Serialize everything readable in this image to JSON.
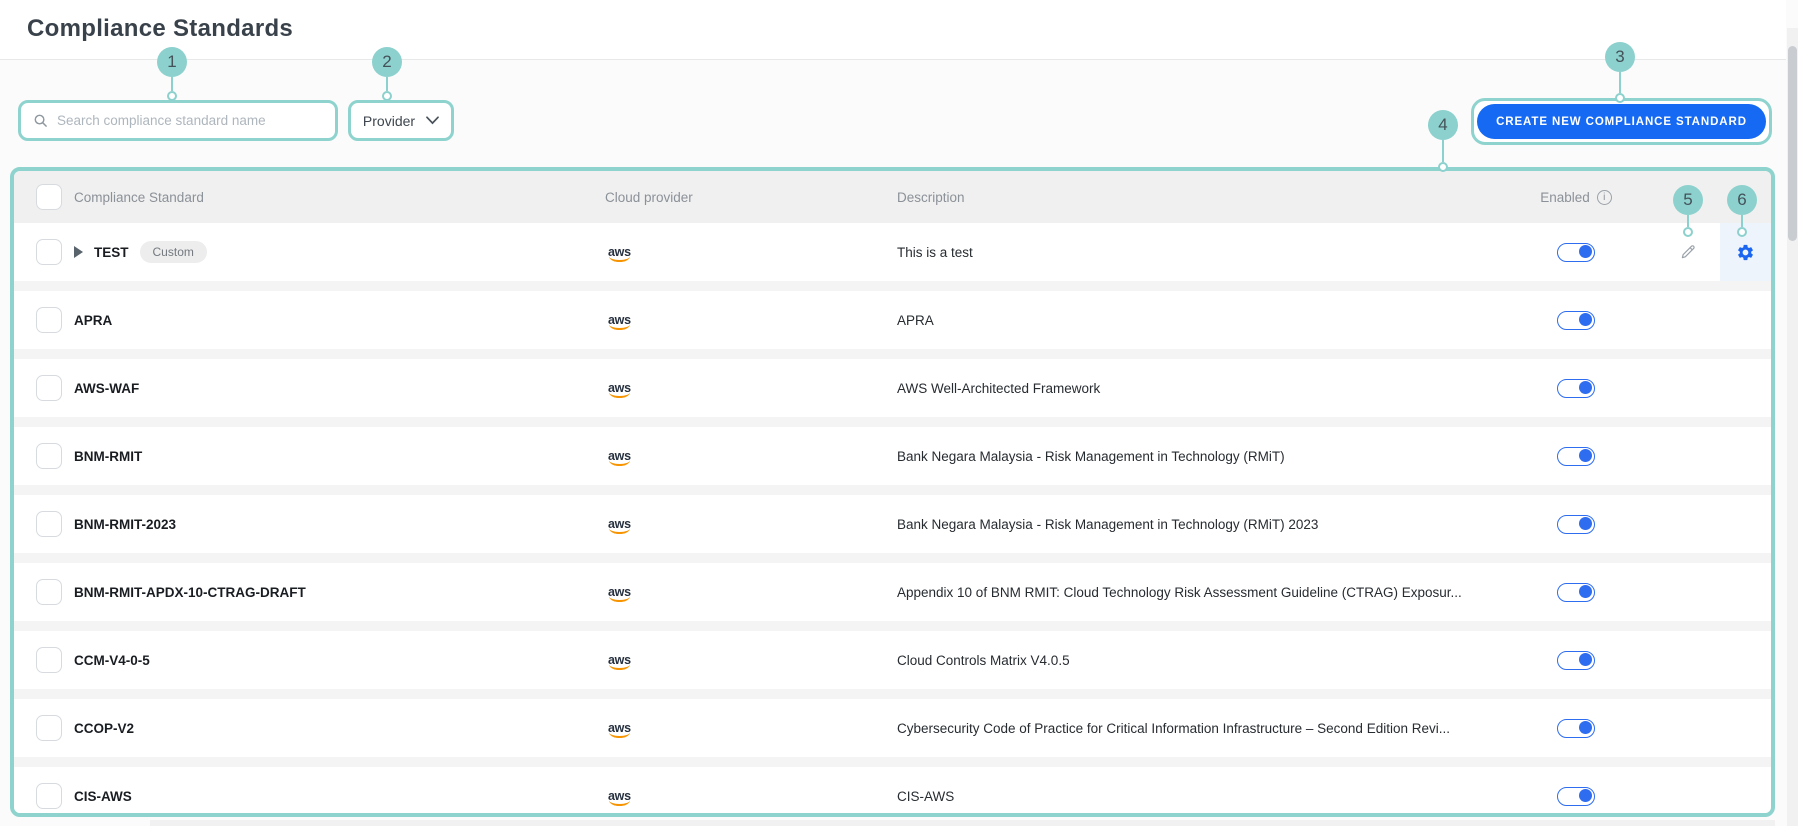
{
  "page": {
    "title": "Compliance Standards"
  },
  "toolbar": {
    "search_placeholder": "Search compliance standard name",
    "provider_filter": "Provider",
    "create_button": "CREATE NEW COMPLIANCE STANDARD"
  },
  "table": {
    "headers": {
      "standard": "Compliance Standard",
      "cloud_provider": "Cloud provider",
      "description": "Description",
      "enabled": "Enabled"
    },
    "rows": [
      {
        "name": "TEST",
        "badge": "Custom",
        "provider": "aws",
        "description": "This is a test",
        "enabled": true,
        "expandable": true,
        "has_actions": true
      },
      {
        "name": "APRA",
        "provider": "aws",
        "description": "APRA",
        "enabled": true
      },
      {
        "name": "AWS-WAF",
        "provider": "aws",
        "description": "AWS Well-Architected Framework",
        "enabled": true
      },
      {
        "name": "BNM-RMIT",
        "provider": "aws",
        "description": "Bank Negara Malaysia - Risk Management in Technology (RMiT)",
        "enabled": true
      },
      {
        "name": "BNM-RMIT-2023",
        "provider": "aws",
        "description": "Bank Negara Malaysia - Risk Management in Technology (RMiT) 2023",
        "enabled": true
      },
      {
        "name": "BNM-RMIT-APDX-10-CTRAG-DRAFT",
        "provider": "aws",
        "description": "Appendix 10 of BNM RMIT: Cloud Technology Risk Assessment Guideline (CTRAG) Exposur...",
        "enabled": true
      },
      {
        "name": "CCM-V4-0-5",
        "provider": "aws",
        "description": "Cloud Controls Matrix V4.0.5",
        "enabled": true
      },
      {
        "name": "CCOP-V2",
        "provider": "aws",
        "description": "Cybersecurity Code of Practice for Critical Information Infrastructure – Second Edition Revi...",
        "enabled": true
      },
      {
        "name": "CIS-AWS",
        "provider": "aws",
        "description": "CIS-AWS",
        "enabled": true
      }
    ]
  },
  "annotations": {
    "labels": [
      "1",
      "2",
      "3",
      "4",
      "5",
      "6"
    ]
  },
  "icons": {
    "info_glyph": "i"
  },
  "colors": {
    "annotation_teal": "#8cd1cd",
    "primary_blue": "#1569f2",
    "toggle_blue": "#2e6cf0",
    "aws_orange": "#f79400",
    "header_bg": "#f0f0f0",
    "settings_highlight": "#edf4fc"
  }
}
